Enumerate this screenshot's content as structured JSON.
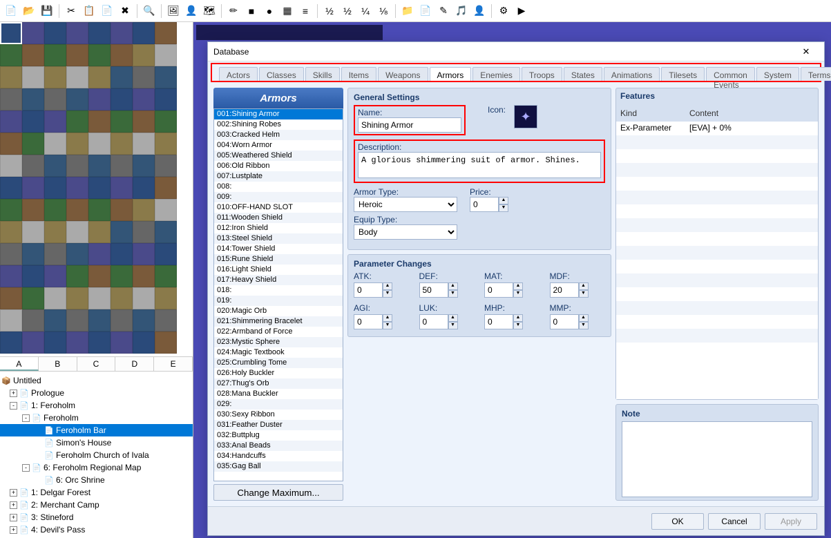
{
  "toolbar": {
    "btns": [
      "📄",
      "📂",
      "💾",
      "|",
      "✂",
      "📋",
      "📄",
      "✖",
      "|",
      "🔍",
      "|",
      "🖼",
      "👤",
      "🗺",
      "|",
      "✏",
      "■",
      "●",
      "▦",
      "≡",
      "|",
      "½",
      "½",
      "¼",
      "⅛",
      "|",
      "📁",
      "📄",
      "✎",
      "🎵",
      "👤",
      "|",
      "⚙",
      "▶"
    ],
    "highlight_index": 25
  },
  "tile_tabs": [
    "A",
    "B",
    "C",
    "D",
    "E"
  ],
  "tile_tab_selected": 0,
  "tree": {
    "root": "Untitled",
    "items": [
      {
        "depth": 0,
        "exp": "+",
        "icon": "📄",
        "label": "Prologue"
      },
      {
        "depth": 0,
        "exp": "-",
        "icon": "📄",
        "label": "1: Feroholm"
      },
      {
        "depth": 1,
        "exp": "-",
        "icon": "📄",
        "label": "Feroholm"
      },
      {
        "depth": 2,
        "exp": "",
        "icon": "📄",
        "label": "Feroholm Bar",
        "sel": true
      },
      {
        "depth": 2,
        "exp": "",
        "icon": "📄",
        "label": "Simon's House"
      },
      {
        "depth": 2,
        "exp": "",
        "icon": "📄",
        "label": "Feroholm Church of Ivala"
      },
      {
        "depth": 1,
        "exp": "-",
        "icon": "📄",
        "label": "6: Feroholm Regional Map"
      },
      {
        "depth": 2,
        "exp": "",
        "icon": "📄",
        "label": "6: Orc Shrine"
      },
      {
        "depth": 0,
        "exp": "+",
        "icon": "📄",
        "label": "1: Delgar Forest"
      },
      {
        "depth": 0,
        "exp": "+",
        "icon": "📄",
        "label": "2: Merchant Camp"
      },
      {
        "depth": 0,
        "exp": "+",
        "icon": "📄",
        "label": "3: Stineford"
      },
      {
        "depth": 0,
        "exp": "+",
        "icon": "📄",
        "label": "4: Devil's Pass"
      }
    ]
  },
  "db": {
    "title": "Database",
    "tabs": [
      "Actors",
      "Classes",
      "Skills",
      "Items",
      "Weapons",
      "Armors",
      "Enemies",
      "Troops",
      "States",
      "Animations",
      "Tilesets",
      "Common Events",
      "System",
      "Terms"
    ],
    "active_tab": 5,
    "list_header": "Armors",
    "items": [
      "001:Shining Armor",
      "002:Shining Robes",
      "003:Cracked Helm",
      "004:Worn Armor",
      "005:Weathered Shield",
      "006:Old Ribbon",
      "007:Lustplate",
      "008:",
      "009:",
      "010:OFF-HAND SLOT",
      "011:Wooden Shield",
      "012:Iron Shield",
      "013:Steel Shield",
      "014:Tower Shield",
      "015:Rune Shield",
      "016:Light Shield",
      "017:Heavy Shield",
      "018:",
      "019:",
      "020:Magic Orb",
      "021:Shimmering Bracelet",
      "022:Armband of Force",
      "023:Mystic Sphere",
      "024:Magic Textbook",
      "025:Crumbling Tome",
      "026:Holy Buckler",
      "027:Thug's Orb",
      "028:Mana Buckler",
      "029:",
      "030:Sexy Ribbon",
      "031:Feather Duster",
      "032:Buttplug",
      "033:Anal Beads",
      "034:Handcuffs",
      "035:Gag Ball"
    ],
    "selected_index": 0,
    "change_max": "Change Maximum...",
    "general": {
      "title": "General Settings",
      "name_label": "Name:",
      "name": "Shining Armor",
      "icon_label": "Icon:",
      "desc_label": "Description:",
      "description": "A glorious shimmering suit of armor. Shines.",
      "armor_type_label": "Armor Type:",
      "armor_type": "Heroic",
      "price_label": "Price:",
      "price": "0",
      "equip_type_label": "Equip Type:",
      "equip_type": "Body"
    },
    "params": {
      "title": "Parameter Changes",
      "labels": {
        "atk": "ATK:",
        "def": "DEF:",
        "mat": "MAT:",
        "mdf": "MDF:",
        "agi": "AGI:",
        "luk": "LUK:",
        "mhp": "MHP:",
        "mmp": "MMP:"
      },
      "values": {
        "atk": "0",
        "def": "50",
        "mat": "0",
        "mdf": "20",
        "agi": "0",
        "luk": "0",
        "mhp": "0",
        "mmp": "0"
      }
    },
    "features": {
      "title": "Features",
      "col1": "Kind",
      "col2": "Content",
      "rows": [
        {
          "kind": "Ex-Parameter",
          "content": "[EVA] + 0%"
        }
      ]
    },
    "note": {
      "title": "Note",
      "value": ""
    },
    "footer": {
      "ok": "OK",
      "cancel": "Cancel",
      "apply": "Apply"
    }
  }
}
